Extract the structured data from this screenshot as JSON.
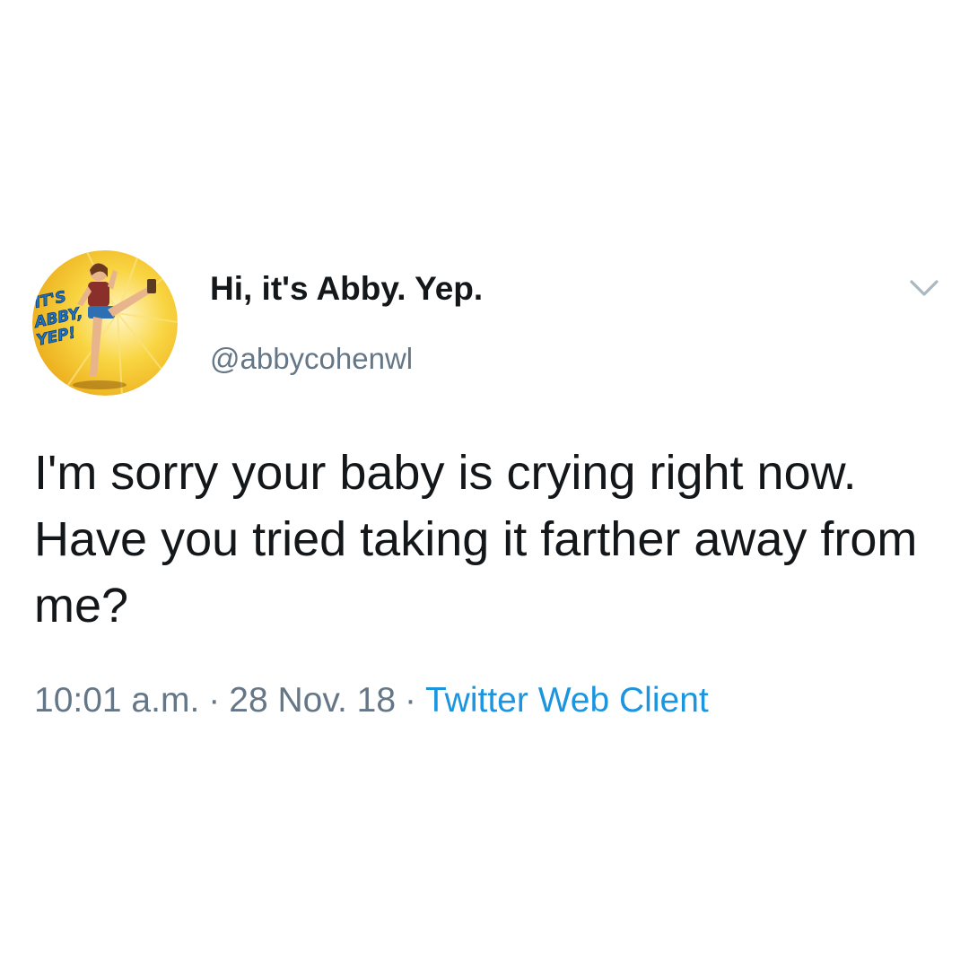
{
  "tweet": {
    "author": {
      "display_name": "Hi, it's Abby. Yep.",
      "handle": "@abbycohenwl",
      "avatar_text": [
        "IT'S",
        "ABBY,",
        "YEP!"
      ]
    },
    "text": "I'm sorry your baby is crying right now. Have you tried taking it farther away from me?",
    "time": "10:01 a.m.",
    "date": "28 Nov. 18",
    "separator": "·",
    "source": "Twitter Web Client",
    "menu_icon": "chevron-down-icon"
  },
  "colors": {
    "text": "#14171a",
    "secondary": "#657786",
    "link": "#1b95e0",
    "avatar_bg": "#f7c62a",
    "avatar_lettering": "#1e74c6"
  }
}
